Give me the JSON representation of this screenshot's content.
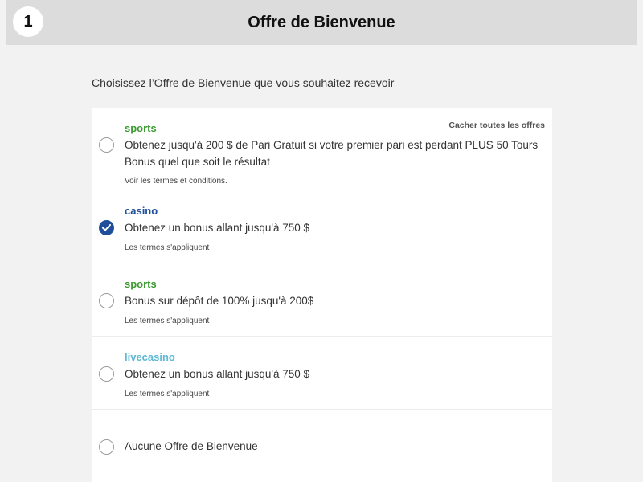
{
  "header": {
    "step_number": "1",
    "title": "Offre de Bienvenue"
  },
  "subtitle": "Choisissez l’Offre de Bienvenue que vous souhaitez recevoir",
  "hide_all_label": "Cacher toutes les offres",
  "offers": [
    {
      "category": "sports",
      "category_color": "#3a9a2f",
      "description": "Obtenez jusqu'à 200 $ de Pari Gratuit si votre premier pari est perdant PLUS 50 Tours Bonus quel que soit le résultat",
      "terms": "Voir les termes et conditions.",
      "selected": false
    },
    {
      "category": "casino",
      "category_color": "#1f4f9a",
      "description": "Obtenez un bonus allant jusqu'à 750 $",
      "terms": "Les termes s'appliquent",
      "selected": true
    },
    {
      "category": "sports",
      "category_color": "#3a9a2f",
      "description": "Bonus sur dépôt de 100% jusqu'à 200$",
      "terms": "Les termes s'appliquent",
      "selected": false
    },
    {
      "category": "livecasino",
      "category_color": "#5bb8d6",
      "description": "Obtenez un bonus allant jusqu'à 750 $",
      "terms": "Les termes s'appliquent",
      "selected": false
    },
    {
      "category": "",
      "description": "Aucune Offre de Bienvenue",
      "terms": "",
      "selected": false
    }
  ],
  "icons": {
    "selected": "check-icon",
    "unselected": "radio-empty-icon"
  }
}
